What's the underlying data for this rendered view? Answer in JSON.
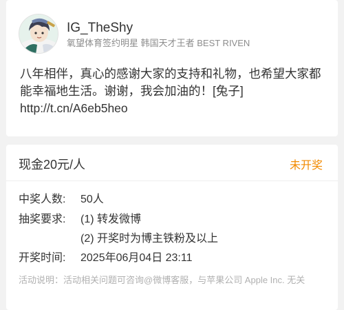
{
  "post": {
    "username": "IG_TheShy",
    "user_description": "氧望体育签约明星 韩国天才王者 BEST RIVEN",
    "text": "八年相伴，真心的感谢大家的支持和礼物，也希望大家都能幸福地生活。谢谢，我会加油的！[兔子]",
    "link": "http://t.cn/A6eb5heo"
  },
  "lottery": {
    "prize": "现金20元/人",
    "status": "未开奖",
    "status_color": "#f28a00",
    "winners_label": "中奖人数:",
    "winners_value": "50人",
    "requirements_label": "抽奖要求:",
    "requirement_1": "(1) 转发微博",
    "requirement_2": "(2) 开奖时为博主铁粉及以上",
    "draw_time_label": "开奖时间:",
    "draw_time_value": "2025年06月04日 23:11",
    "note": "活动说明：活动相关问题可咨询@微博客服，与苹果公司 Apple Inc. 无关"
  },
  "icons": {
    "avatar": "user-avatar-illustration"
  }
}
